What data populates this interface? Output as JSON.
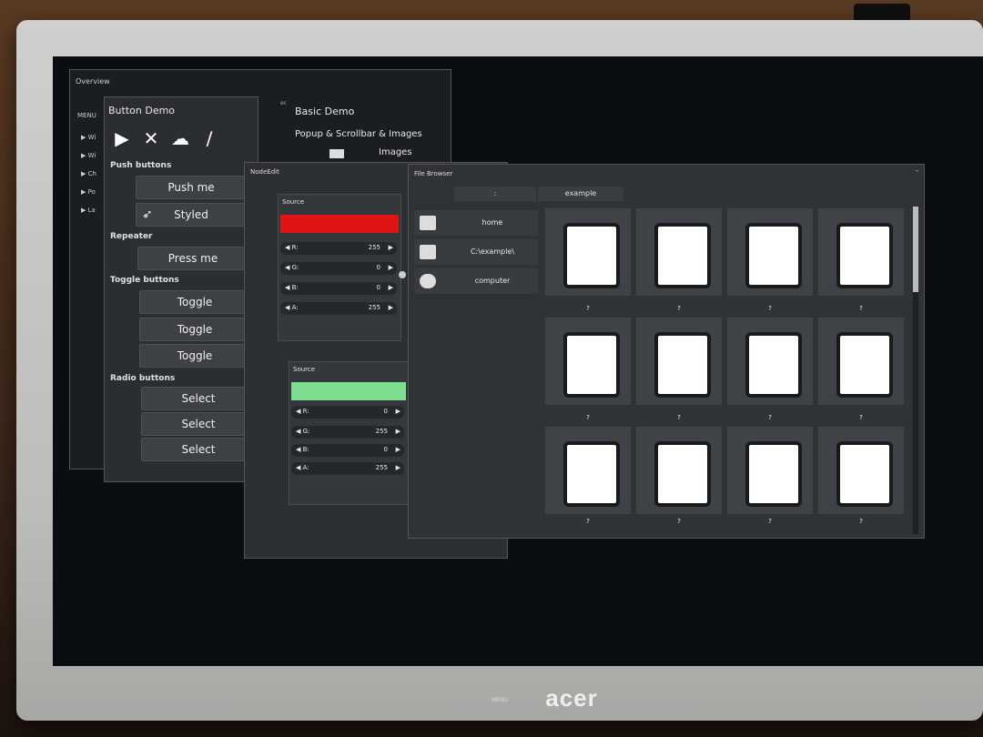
{
  "overview": {
    "title": "Overview",
    "menu_label": "MENU",
    "menu_items": [
      "Wi",
      "Wi",
      "Ch",
      "Po",
      "La"
    ]
  },
  "button_demo": {
    "title": "Button Demo",
    "icons": [
      "play-icon",
      "tools-icon",
      "cloud-icon",
      "brush-icon"
    ],
    "sections": {
      "push": "Push buttons",
      "repeater": "Repeater",
      "toggle": "Toggle buttons",
      "radio": "Radio buttons"
    },
    "push_buttons": [
      "Push me",
      "Styled"
    ],
    "repeater_button": "Press me",
    "toggle_buttons": [
      "Toggle",
      "Toggle",
      "Toggle"
    ],
    "radio_buttons": [
      "Select",
      "Select",
      "Select"
    ]
  },
  "basic_demo": {
    "partial_label": "ec",
    "title": "Basic Demo",
    "popup_title": "Popup & Scrollbar & Images",
    "images_label": "Images"
  },
  "node_edit": {
    "title": "NodeEdit",
    "nodes": [
      {
        "title": "Source",
        "color": "#e01414",
        "rows": [
          {
            "label": "R:",
            "value": "255"
          },
          {
            "label": "G:",
            "value": "0"
          },
          {
            "label": "B:",
            "value": "0"
          },
          {
            "label": "A:",
            "value": "255"
          }
        ]
      },
      {
        "title": "Source",
        "color": "#7dde8f",
        "rows": [
          {
            "label": "R:",
            "value": "0"
          },
          {
            "label": "G:",
            "value": "255"
          },
          {
            "label": "B:",
            "value": "0"
          },
          {
            "label": "A:",
            "value": "255"
          }
        ]
      }
    ]
  },
  "file_browser": {
    "title": "File Browser",
    "close_icon": "-",
    "path": [
      ":",
      "example"
    ],
    "places": [
      {
        "label": "home",
        "icon": "home-drive-icon"
      },
      {
        "label": "C:\\example\\",
        "icon": "drive-icon"
      },
      {
        "label": "computer",
        "icon": "computer-icon"
      }
    ],
    "files": [
      "?",
      "?",
      "?",
      "?",
      "?",
      "?",
      "?",
      "?",
      "?",
      "?",
      "?",
      "?"
    ]
  },
  "monitor": {
    "brand": "acer",
    "tray_label": "MENU"
  }
}
